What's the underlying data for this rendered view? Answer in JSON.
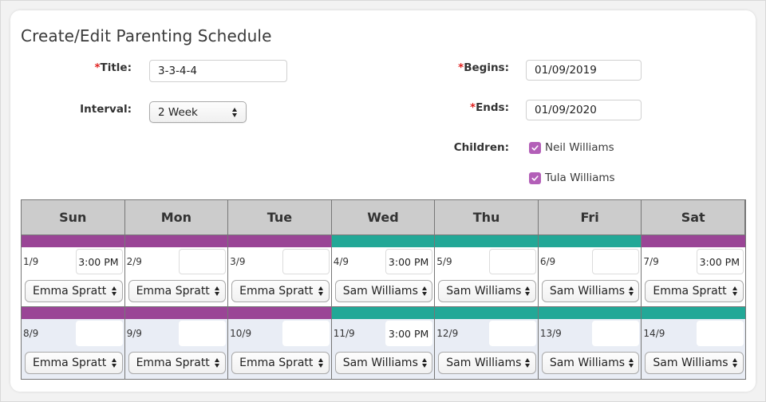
{
  "page": {
    "title": "Create/Edit Parenting Schedule"
  },
  "form": {
    "required_marker": "*",
    "title_label": "Title:",
    "title_value": "3-3-4-4",
    "interval_label": "Interval:",
    "interval_value": "2 Week",
    "begins_label": "Begins:",
    "begins_value": "01/09/2019",
    "ends_label": "Ends:",
    "ends_value": "01/09/2020",
    "children_label": "Children:",
    "children": [
      {
        "name": "Neil Williams",
        "checked": true
      },
      {
        "name": "Tula Williams",
        "checked": true
      }
    ]
  },
  "colors": {
    "parent_a": "#9a4596",
    "parent_b": "#22a897",
    "checkbox": "#b35fb8",
    "required": "#e0201e"
  },
  "schedule": {
    "days": [
      "Sun",
      "Mon",
      "Tue",
      "Wed",
      "Thu",
      "Fri",
      "Sat"
    ],
    "weeks": [
      [
        {
          "date": "1/9",
          "time": "3:00 PM",
          "parent": "Emma Spratt",
          "color": "parent_a"
        },
        {
          "date": "2/9",
          "time": "",
          "parent": "Emma Spratt",
          "color": "parent_a"
        },
        {
          "date": "3/9",
          "time": "",
          "parent": "Emma Spratt",
          "color": "parent_a"
        },
        {
          "date": "4/9",
          "time": "3:00 PM",
          "parent": "Sam Williams",
          "color": "parent_b"
        },
        {
          "date": "5/9",
          "time": "",
          "parent": "Sam Williams",
          "color": "parent_b"
        },
        {
          "date": "6/9",
          "time": "",
          "parent": "Sam Williams",
          "color": "parent_b"
        },
        {
          "date": "7/9",
          "time": "3:00 PM",
          "parent": "Emma Spratt",
          "color": "parent_a"
        }
      ],
      [
        {
          "date": "8/9",
          "time": "",
          "parent": "Emma Spratt",
          "color": "parent_a"
        },
        {
          "date": "9/9",
          "time": "",
          "parent": "Emma Spratt",
          "color": "parent_a"
        },
        {
          "date": "10/9",
          "time": "",
          "parent": "Emma Spratt",
          "color": "parent_a"
        },
        {
          "date": "11/9",
          "time": "3:00 PM",
          "parent": "Sam Williams",
          "color": "parent_b"
        },
        {
          "date": "12/9",
          "time": "",
          "parent": "Sam Williams",
          "color": "parent_b"
        },
        {
          "date": "13/9",
          "time": "",
          "parent": "Sam Williams",
          "color": "parent_b"
        },
        {
          "date": "14/9",
          "time": "",
          "parent": "Sam Williams",
          "color": "parent_b"
        }
      ]
    ]
  }
}
